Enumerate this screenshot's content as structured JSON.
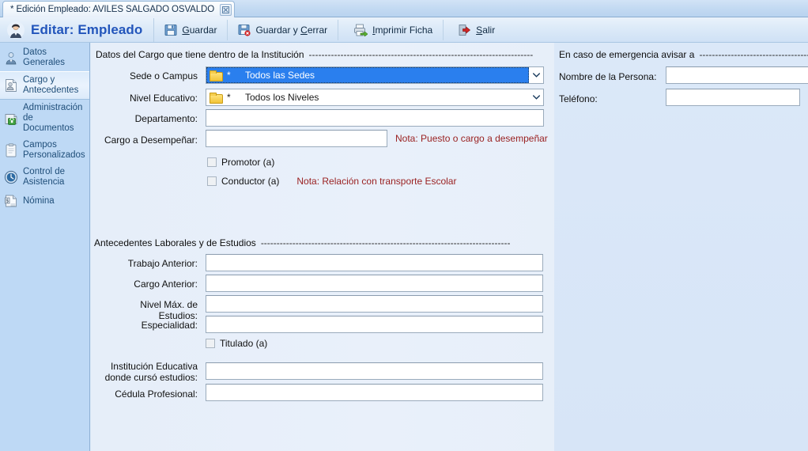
{
  "window": {
    "tab_title": "* Edición Empleado: AVILES SALGADO OSVALDO",
    "close_icon": "close-icon"
  },
  "header": {
    "title": "Editar: Empleado",
    "avatar_icon": "employee-avatar-icon",
    "buttons": [
      {
        "label": "Guardar",
        "icon": "save-icon"
      },
      {
        "label": "Guardar y Cerrar",
        "icon": "save-and-close-icon"
      },
      {
        "label": "Imprimir Ficha",
        "icon": "printer-icon"
      },
      {
        "label": "Salir",
        "icon": "exit-icon"
      }
    ]
  },
  "sidebar": {
    "items": [
      {
        "label": "Datos Generales",
        "icon": "person-icon",
        "selected": false
      },
      {
        "label": "Cargo y Antecedentes",
        "icon": "document-person-icon",
        "selected": true
      },
      {
        "label": "Administración de Documentos",
        "icon": "folder-lock-icon",
        "selected": false
      },
      {
        "label": "Campos Personalizados",
        "icon": "clipboard-icon",
        "selected": false
      },
      {
        "label": "Control de Asistencia",
        "icon": "clock-icon",
        "selected": false
      },
      {
        "label": "Nómina",
        "icon": "payroll-icon",
        "selected": false
      }
    ]
  },
  "sections": {
    "cargo": {
      "title": "Datos del Cargo que tiene dentro de la Institución",
      "rule": "-----------------------------------------------------------------------",
      "fields": {
        "sede_label": "Sede o Campus",
        "sede_value": "Todos las Sedes",
        "sede_star": "*",
        "nivel_label": "Nivel Educativo:",
        "nivel_value": "Todos los Niveles",
        "nivel_star": "*",
        "departamento_label": "Departamento:",
        "departamento_value": "",
        "cargo_label": "Cargo a Desempeñar:",
        "cargo_value": "",
        "cargo_note": "Nota: Puesto o cargo a desempeñar"
      },
      "checkboxes": [
        {
          "label": "Promotor (a)",
          "checked": false,
          "note": ""
        },
        {
          "label": "Conductor (a)",
          "checked": false,
          "note": "Nota: Relación con transporte Escolar"
        }
      ]
    },
    "antecedentes": {
      "title": "Antecedentes Laborales y de Estudios",
      "rule": "-------------------------------------------------------------------------------",
      "fields": {
        "trabajo_label": "Trabajo Anterior:",
        "trabajo_value": "",
        "cargo_ant_label": "Cargo Anterior:",
        "cargo_ant_value": "",
        "nivel_max_label": "Nivel Máx. de Estudios:",
        "nivel_max_value": "",
        "especialidad_label": "Especialidad:",
        "especialidad_value": "",
        "institucion_label_1": "Institución Educativa",
        "institucion_label_2": "donde cursó estudios:",
        "institucion_value": "",
        "cedula_label": "Cédula Profesional:",
        "cedula_value": ""
      },
      "checkbox": {
        "label": "Titulado (a)",
        "checked": false
      }
    },
    "emergencia": {
      "title": "En caso de emergencia avisar a",
      "rule": "-------------------------------------",
      "fields": {
        "nombre_label": "Nombre de la Persona:",
        "nombre_value": "",
        "telefono_label": "Teléfono:",
        "telefono_value": ""
      }
    }
  },
  "colors": {
    "accent_blue": "#2255bb",
    "sidebar_blue": "#bed9f5",
    "selection_blue": "#2a7fee",
    "note_red": "#9a2222",
    "folder_yellow": "#f2c438"
  }
}
